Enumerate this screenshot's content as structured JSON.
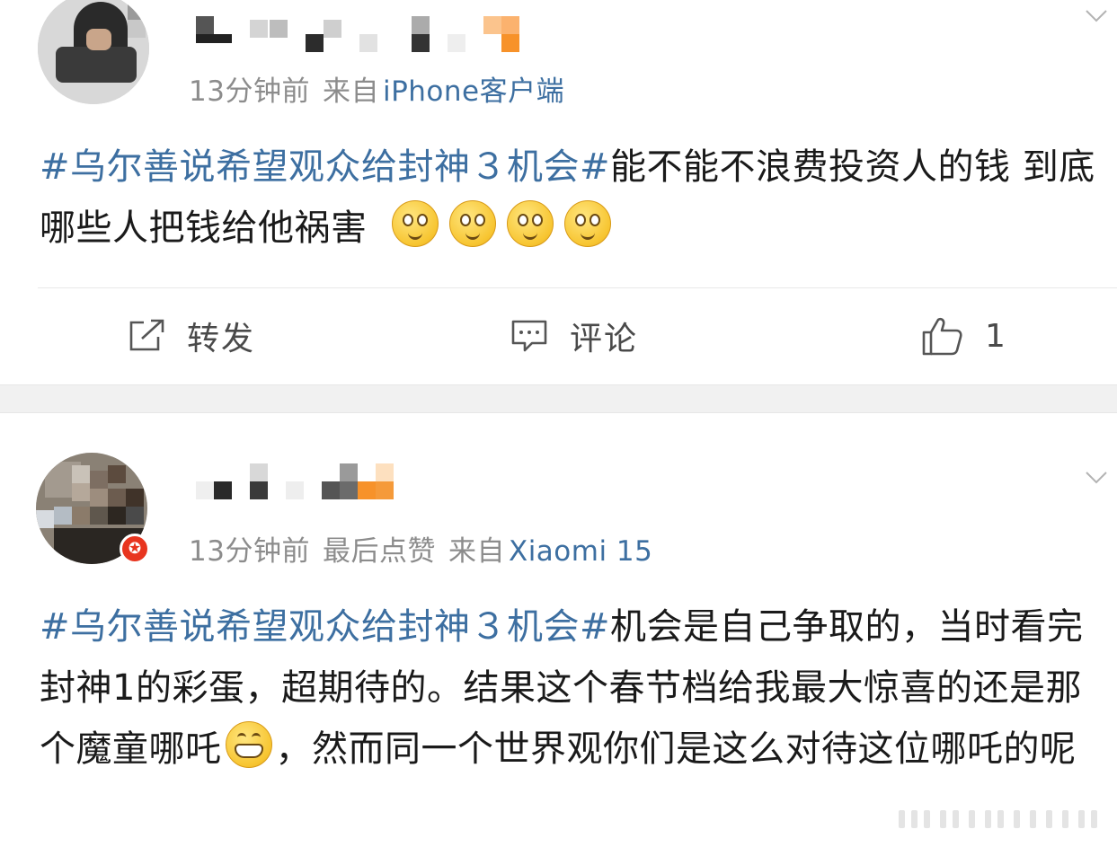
{
  "posts": [
    {
      "time": "13分钟前",
      "liked_label": "",
      "source_prefix": "来自",
      "source": "iPhone客户端",
      "hashtag": "#乌尔善说希望观众给封神３机会#",
      "text": "能不能不浪费投资人的钱 到底哪些人把钱给他祸害",
      "emojis": [
        "dizzy-face-emoji",
        "dizzy-face-emoji",
        "dizzy-face-emoji",
        "dizzy-face-emoji"
      ],
      "actions": {
        "repost_label": "转发",
        "comment_label": "评论",
        "like_count": "1"
      }
    },
    {
      "time": "13分钟前",
      "liked_label": "最后点赞",
      "source_prefix": "来自",
      "source": "Xiaomi 15",
      "hashtag": "#乌尔善说希望观众给封神３机会#",
      "text_before_emoji": "机会是自己争取的，当时看完封神1的彩蛋，超期待的。结果这个春节档给我最大惊喜的还是那个魔童哪吒",
      "text_after_emoji": "，然而同一个世界观你们是这么对待这位哪吒的呢",
      "emoji": "grinning-face-emoji",
      "verified_badge": "✪"
    }
  ],
  "colors": {
    "link": "#3d6fa1",
    "meta": "#8c8c8c",
    "badge": "#e8351f",
    "separator": "#f1f1f1"
  },
  "icons": [
    "chevron-down-icon",
    "repost-icon",
    "comment-icon",
    "like-icon"
  ]
}
